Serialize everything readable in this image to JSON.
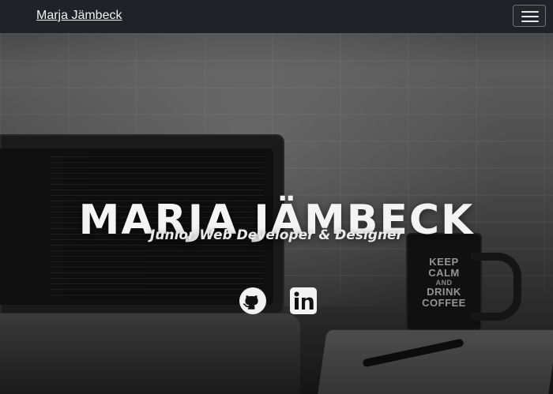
{
  "navbar": {
    "brand": "Marja Jämbeck",
    "menu_button_icon": "hamburger-menu-icon"
  },
  "hero": {
    "title": "MARJA JÄMBECK",
    "subtitle": "Junior Web Developer & Designer"
  },
  "social": {
    "github_icon": "github-icon",
    "linkedin_icon": "linkedin-icon"
  },
  "decorations": {
    "mug_text": {
      "line1": "KEEP",
      "line2": "CALM",
      "line3": "AND",
      "line4": "DRINK",
      "line5": "COFFEE"
    }
  },
  "colors": {
    "navbar_bg": "#1f2226",
    "text_primary": "#f4f4f4"
  }
}
